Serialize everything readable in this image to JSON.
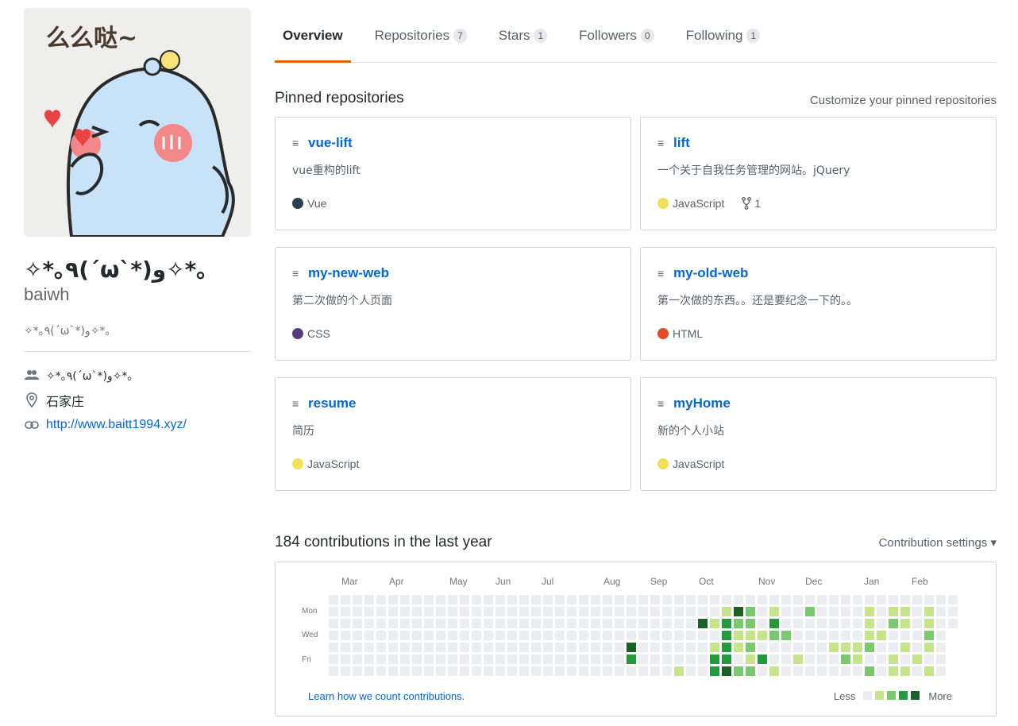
{
  "profile": {
    "fullname": "✧*｡٩(ˊωˋ*)و✧*｡",
    "username": "baiwh",
    "bio": "✧*｡٩(ˊωˋ*)و✧*｡",
    "avatar_text": "么么哒~",
    "organization": "✧*｡٩(ˊωˋ*)و✧*｡",
    "location": "石家庄",
    "website": "http://www.baitt1994.xyz/"
  },
  "tabs": [
    {
      "label": "Overview",
      "count": null,
      "active": true
    },
    {
      "label": "Repositories",
      "count": "7"
    },
    {
      "label": "Stars",
      "count": "1"
    },
    {
      "label": "Followers",
      "count": "0"
    },
    {
      "label": "Following",
      "count": "1"
    }
  ],
  "pinned": {
    "title": "Pinned repositories",
    "customize_link": "Customize your pinned repositories",
    "repos": [
      {
        "name": "vue-lift",
        "description": "vue重构的lift",
        "language": "Vue",
        "color": "#2c3e50",
        "forks": null
      },
      {
        "name": "lift",
        "description": "一个关于自我任务管理的网站。jQuery",
        "language": "JavaScript",
        "color": "#f1e05a",
        "forks": "1"
      },
      {
        "name": "my-new-web",
        "description": "第二次做的个人页面",
        "language": "CSS",
        "color": "#563d7c",
        "forks": null
      },
      {
        "name": "my-old-web",
        "description": "第一次做的东西。。还是要纪念一下的。。",
        "language": "HTML",
        "color": "#e34c26",
        "forks": null
      },
      {
        "name": "resume",
        "description": "简历",
        "language": "JavaScript",
        "color": "#f1e05a",
        "forks": null
      },
      {
        "name": "myHome",
        "description": "新的个人小站",
        "language": "JavaScript",
        "color": "#f1e05a",
        "forks": null
      }
    ]
  },
  "contributions": {
    "title": "184 contributions in the last year",
    "settings_label": "Contribution settings ▾",
    "months": [
      "Mar",
      "Apr",
      "May",
      "Jun",
      "Jul",
      "Aug",
      "Sep",
      "Oct",
      "Nov",
      "Dec",
      "Jan",
      "Feb"
    ],
    "days": [
      "Mon",
      "Wed",
      "Fri"
    ],
    "learn_link": "Learn how we count contributions.",
    "less_label": "Less",
    "more_label": "More",
    "colors": [
      "#ebedf0",
      "#c6e48b",
      "#7bc96f",
      "#239a3b",
      "#196127"
    ],
    "cells": [
      {
        "w": 25,
        "d": 4,
        "l": 4
      },
      {
        "w": 25,
        "d": 5,
        "l": 3
      },
      {
        "w": 25,
        "d": 7,
        "l": 1
      },
      {
        "w": 29,
        "d": 6,
        "l": 1
      },
      {
        "w": 31,
        "d": 2,
        "l": 4
      },
      {
        "w": 32,
        "d": 2,
        "l": 1
      },
      {
        "w": 32,
        "d": 4,
        "l": 1
      },
      {
        "w": 32,
        "d": 5,
        "l": 3
      },
      {
        "w": 32,
        "d": 6,
        "l": 3
      },
      {
        "w": 33,
        "d": 1,
        "l": 1
      },
      {
        "w": 33,
        "d": 2,
        "l": 3
      },
      {
        "w": 33,
        "d": 3,
        "l": 3
      },
      {
        "w": 33,
        "d": 4,
        "l": 3
      },
      {
        "w": 33,
        "d": 5,
        "l": 3
      },
      {
        "w": 33,
        "d": 6,
        "l": 4
      },
      {
        "w": 33,
        "d": 7,
        "l": 2
      },
      {
        "w": 34,
        "d": 1,
        "l": 4
      },
      {
        "w": 34,
        "d": 2,
        "l": 2
      },
      {
        "w": 34,
        "d": 3,
        "l": 1
      },
      {
        "w": 34,
        "d": 4,
        "l": 1
      },
      {
        "w": 34,
        "d": 6,
        "l": 2
      },
      {
        "w": 34,
        "d": 7,
        "l": 1
      },
      {
        "w": 35,
        "d": 1,
        "l": 2
      },
      {
        "w": 35,
        "d": 2,
        "l": 2
      },
      {
        "w": 35,
        "d": 3,
        "l": 1
      },
      {
        "w": 35,
        "d": 4,
        "l": 2
      },
      {
        "w": 35,
        "d": 5,
        "l": 1
      },
      {
        "w": 35,
        "d": 6,
        "l": 2
      },
      {
        "w": 36,
        "d": 3,
        "l": 1
      },
      {
        "w": 36,
        "d": 5,
        "l": 3
      },
      {
        "w": 37,
        "d": 1,
        "l": 1
      },
      {
        "w": 37,
        "d": 2,
        "l": 3
      },
      {
        "w": 37,
        "d": 3,
        "l": 2
      },
      {
        "w": 37,
        "d": 6,
        "l": 1
      },
      {
        "w": 37,
        "d": 7,
        "l": 1
      },
      {
        "w": 38,
        "d": 3,
        "l": 2
      },
      {
        "w": 39,
        "d": 5,
        "l": 1
      },
      {
        "w": 40,
        "d": 1,
        "l": 2
      },
      {
        "w": 42,
        "d": 4,
        "l": 1
      },
      {
        "w": 43,
        "d": 4,
        "l": 1
      },
      {
        "w": 43,
        "d": 5,
        "l": 2
      },
      {
        "w": 43,
        "d": 7,
        "l": 2
      },
      {
        "w": 44,
        "d": 4,
        "l": 1
      },
      {
        "w": 44,
        "d": 5,
        "l": 1
      },
      {
        "w": 45,
        "d": 1,
        "l": 1
      },
      {
        "w": 45,
        "d": 2,
        "l": 1
      },
      {
        "w": 45,
        "d": 3,
        "l": 1
      },
      {
        "w": 45,
        "d": 4,
        "l": 2
      },
      {
        "w": 45,
        "d": 6,
        "l": 2
      },
      {
        "w": 45,
        "d": 7,
        "l": 1
      },
      {
        "w": 46,
        "d": 3,
        "l": 1
      },
      {
        "w": 47,
        "d": 1,
        "l": 1
      },
      {
        "w": 47,
        "d": 2,
        "l": 2
      },
      {
        "w": 47,
        "d": 5,
        "l": 1
      },
      {
        "w": 47,
        "d": 6,
        "l": 1
      },
      {
        "w": 48,
        "d": 1,
        "l": 1
      },
      {
        "w": 48,
        "d": 2,
        "l": 1
      },
      {
        "w": 48,
        "d": 4,
        "l": 1
      },
      {
        "w": 48,
        "d": 6,
        "l": 1
      },
      {
        "w": 49,
        "d": 5,
        "l": 1
      },
      {
        "w": 50,
        "d": 1,
        "l": 1
      },
      {
        "w": 50,
        "d": 2,
        "l": 1
      },
      {
        "w": 50,
        "d": 3,
        "l": 2
      },
      {
        "w": 50,
        "d": 4,
        "l": 1
      },
      {
        "w": 50,
        "d": 6,
        "l": 1
      },
      {
        "w": 51,
        "d": 7,
        "l": 1
      }
    ]
  }
}
